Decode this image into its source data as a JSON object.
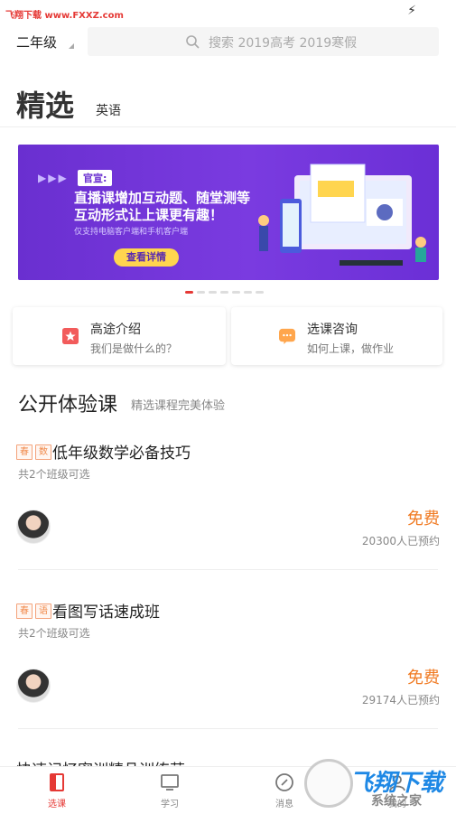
{
  "status": {
    "watermark": "飞翔下载 www.FXXZ.com"
  },
  "header": {
    "grade": "二年级",
    "search_placeholder": "搜索 2019高考 2019寒假"
  },
  "tabs": {
    "main": "精选",
    "secondary": "英语"
  },
  "banner": {
    "tag": "官宣:",
    "line1": "直播课增加互动题、随堂测等",
    "line2": "互动形式让上课更有趣！",
    "note": "仅支持电脑客户端和手机客户端",
    "button": "查看详情"
  },
  "carousel": {
    "count": 8,
    "active_index": 0
  },
  "cards": [
    {
      "title": "高途介绍",
      "subtitle": "我们是做什么的？",
      "icon": "bookmark-icon",
      "color": "#f25b5b"
    },
    {
      "title": "选课咨询",
      "subtitle": "如何上课，做作业",
      "icon": "chat-icon",
      "color": "#ffa64d"
    }
  ],
  "section": {
    "title": "公开体验课",
    "subtitle": "精选课程完美体验"
  },
  "courses": [
    {
      "tags": [
        "春",
        "数"
      ],
      "title": "低年级数学必备技巧",
      "classes": "共2个班级可选",
      "price": "免费",
      "booked": "20300人已预约"
    },
    {
      "tags": [
        "春",
        "语"
      ],
      "title": "看图写话速成班",
      "classes": "共2个班级可选",
      "price": "免费",
      "booked": "29174人已预约"
    }
  ],
  "partial_course": {
    "title": "快速记忆密训精品训练营"
  },
  "bottom_nav": [
    {
      "label": "选课",
      "icon": "course-select-icon",
      "active": true
    },
    {
      "label": "学习",
      "icon": "monitor-icon",
      "active": false
    },
    {
      "label": "消息",
      "icon": "compass-icon",
      "active": false
    },
    {
      "label": "我的",
      "icon": "profile-icon",
      "active": false
    }
  ],
  "watermark_corner": {
    "big": "飞翔下载",
    "small": "系统之家"
  },
  "accent": "#e53935"
}
